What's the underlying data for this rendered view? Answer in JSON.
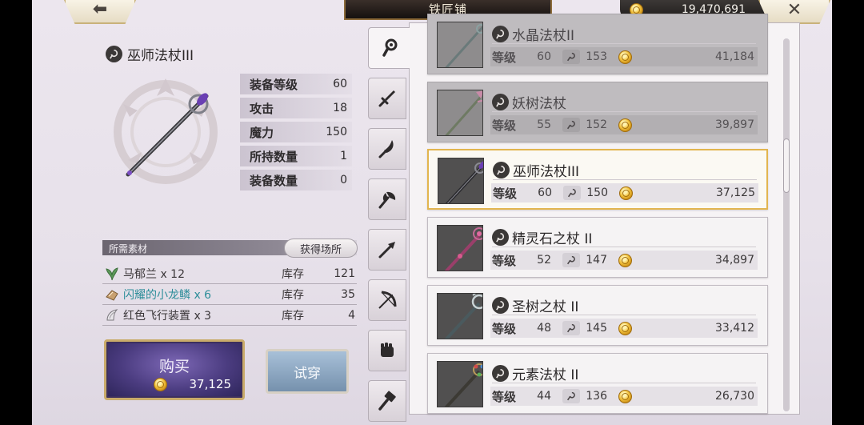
{
  "header": {
    "back_icon": "left-arrow-icon",
    "title": "铁匠铺",
    "gold": "19,470,691",
    "close_icon": "close-x-icon"
  },
  "item": {
    "name": "巫师法杖III",
    "stats": [
      {
        "label": "装备等级",
        "value": "60"
      },
      {
        "label": "攻击",
        "value": "18"
      },
      {
        "label": "魔力",
        "value": "150"
      },
      {
        "label": "所持数量",
        "value": "1"
      },
      {
        "label": "装备数量",
        "value": "0"
      }
    ]
  },
  "materials": {
    "header": "所需素材",
    "source_button": "获得场所",
    "stock_label": "库存",
    "items": [
      {
        "name": "马郁兰 x 12",
        "stock": "121",
        "icon": "herb-icon"
      },
      {
        "name": "闪耀的小龙鳞 x 6",
        "stock": "35",
        "icon": "scale-icon"
      },
      {
        "name": "红色飞行装置 x 3",
        "stock": "4",
        "icon": "wing-icon"
      }
    ]
  },
  "buy": {
    "label": "购买",
    "price": "37,125"
  },
  "try_on": {
    "label": "试穿"
  },
  "tabs": [
    "staff-tab",
    "sword-tab",
    "blade-tab",
    "axe-tab",
    "spear-tab",
    "bow-tab",
    "glove-tab",
    "hammer-tab"
  ],
  "list": {
    "level_label": "等级",
    "rows": [
      {
        "name": "水晶法杖II",
        "level": "60",
        "magic": "153",
        "price": "41,184",
        "state": "faded"
      },
      {
        "name": "妖树法杖",
        "level": "55",
        "magic": "152",
        "price": "39,897",
        "state": "faded"
      },
      {
        "name": "巫师法杖III",
        "level": "60",
        "magic": "150",
        "price": "37,125",
        "state": "selected"
      },
      {
        "name": "精灵石之杖 II",
        "level": "52",
        "magic": "147",
        "price": "34,897",
        "state": "normal"
      },
      {
        "name": "圣树之杖 II",
        "level": "48",
        "magic": "145",
        "price": "33,412",
        "state": "normal"
      },
      {
        "name": "元素法杖 II",
        "level": "44",
        "magic": "136",
        "price": "26,730",
        "state": "normal"
      }
    ]
  },
  "colors": {
    "selected_border": "#e2b54f",
    "buy_button": "#4b3c80",
    "highlight_text": "#2c8d99"
  }
}
